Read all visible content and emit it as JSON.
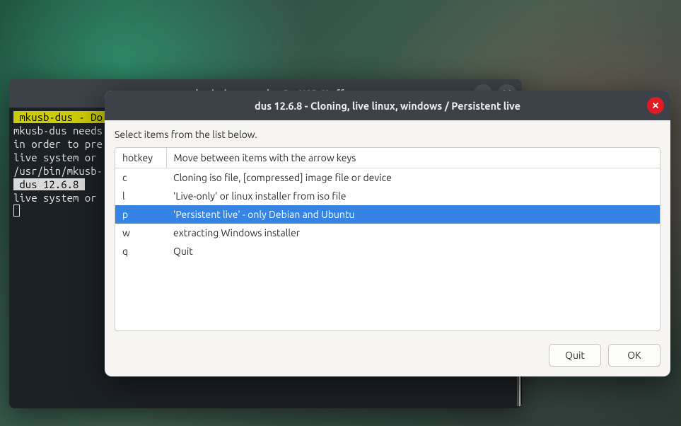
{
  "terminal": {
    "title": "mkusb-dus console - Do USB Stuff",
    "lines": {
      "l1_hl": " mkusb-dus - Do USB Stuff ",
      "l2": "mkusb-dus needs",
      "l3": "in order to pre",
      "l4": "live system or ",
      "l5": "/usr/bin/mkusb-",
      "l6_hl": " dus 12.6.8 ",
      "l7": "live system or "
    }
  },
  "dialog": {
    "title": "dus 12.6.8 - Cloning, live linux, windows / Persistent live",
    "instruction": "Select items from the list below.",
    "columns": {
      "hotkey": "hotkey",
      "desc": "Move between items with the arrow keys"
    },
    "rows": [
      {
        "hotkey": "c",
        "desc": "Cloning iso file, [compressed] image file or device",
        "selected": false
      },
      {
        "hotkey": "l",
        "desc": "'Live-only' or linux installer from iso file",
        "selected": false
      },
      {
        "hotkey": "p",
        "desc": "'Persistent live' - only Debian and Ubuntu",
        "selected": true
      },
      {
        "hotkey": "w",
        "desc": "extracting Windows installer",
        "selected": false
      },
      {
        "hotkey": "q",
        "desc": "Quit",
        "selected": false
      }
    ],
    "buttons": {
      "quit": "Quit",
      "ok": "OK"
    }
  }
}
